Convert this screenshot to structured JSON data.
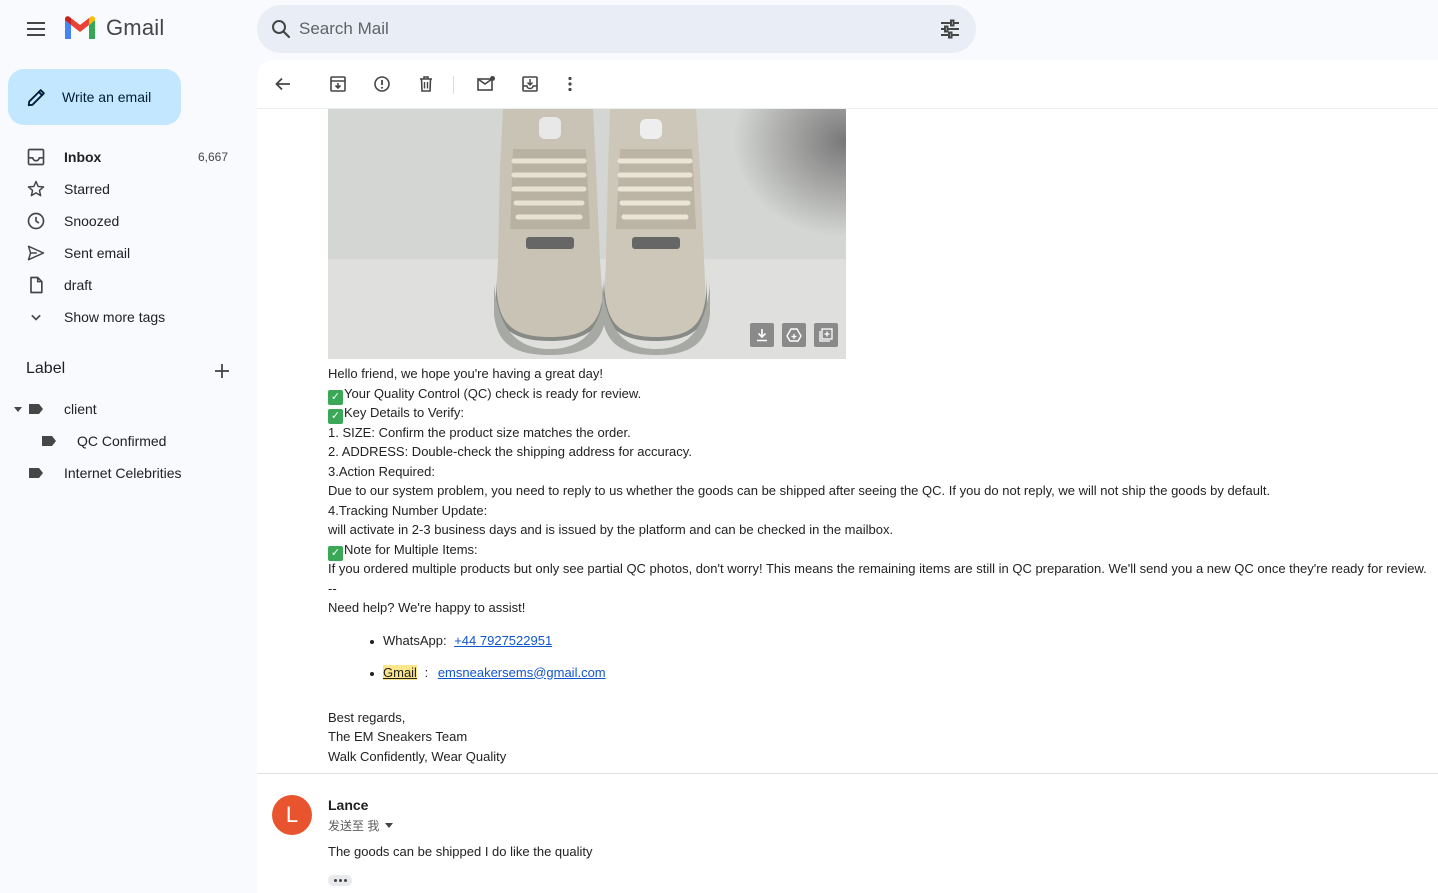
{
  "app": {
    "name": "Gmail"
  },
  "search": {
    "placeholder": "Search Mail"
  },
  "compose": {
    "label": "Write an email"
  },
  "nav": [
    {
      "label": "Inbox",
      "count": "6,667",
      "icon": "inbox-icon"
    },
    {
      "label": "Starred",
      "count": "",
      "icon": "star-icon"
    },
    {
      "label": "Snoozed",
      "count": "",
      "icon": "clock-icon"
    },
    {
      "label": "Sent email",
      "count": "",
      "icon": "send-icon"
    },
    {
      "label": "draft",
      "count": "",
      "icon": "draft-icon"
    },
    {
      "label": "Show more tags",
      "count": "",
      "icon": "chevron-down-icon"
    }
  ],
  "labels": {
    "title": "Label",
    "items": [
      {
        "label": "client"
      },
      {
        "label": "QC Confirmed"
      },
      {
        "label": "Internet Celebrities"
      }
    ]
  },
  "toolbar": {
    "icons": [
      "back-arrow-icon",
      "archive-icon",
      "report-spam-icon",
      "delete-icon",
      "mark-unread-icon",
      "move-to-icon",
      "more-options-icon"
    ]
  },
  "email": {
    "attachment_actions": [
      "download-icon",
      "save-to-drive-icon",
      "add-to-photos-icon"
    ],
    "lines": {
      "l1": "Hello friend, we hope you're having a great day!",
      "l2": "Your Quality Control (QC) check is ready for review.",
      "l3": "Key Details to Verify:",
      "l4": "1. SIZE: Confirm the product size matches the order.",
      "l5": "2. ADDRESS: Double-check the shipping address for accuracy.",
      "l6": "3.Action Required:",
      "l7": "Due to our system problem, you need to reply to us whether the goods can be shipped after seeing the QC. If you do not reply, we will not ship the goods by default.",
      "l8": "4.Tracking Number Update:",
      "l9": "will activate in 2-3 business days and is issued by the platform and can be checked in the mailbox.",
      "l10": "Note for Multiple Items:",
      "l11": "If you ordered multiple products but only see partial QC photos, don't worry! This means the remaining items are still in QC preparation. We'll send you a new QC once they're ready for review.",
      "l12": "--",
      "l13": "Need help? We're happy to assist!"
    },
    "contacts": {
      "whatsapp_label": "WhatsApp:",
      "whatsapp_value": "+44 7927522951",
      "gmail_label": "Gmail",
      "gmail_sep": ":",
      "gmail_value": "emsneakersems@gmail.com"
    },
    "signoff": {
      "s1": "Best regards,",
      "s2": "The EM Sneakers Team",
      "s3": "Walk Confidently, Wear Quality"
    }
  },
  "reply": {
    "avatar_letter": "L",
    "avatar_color": "#e8542d",
    "sender": "Lance",
    "to_label": "发送至 我",
    "body": "The goods can be shipped I do like the quality"
  }
}
